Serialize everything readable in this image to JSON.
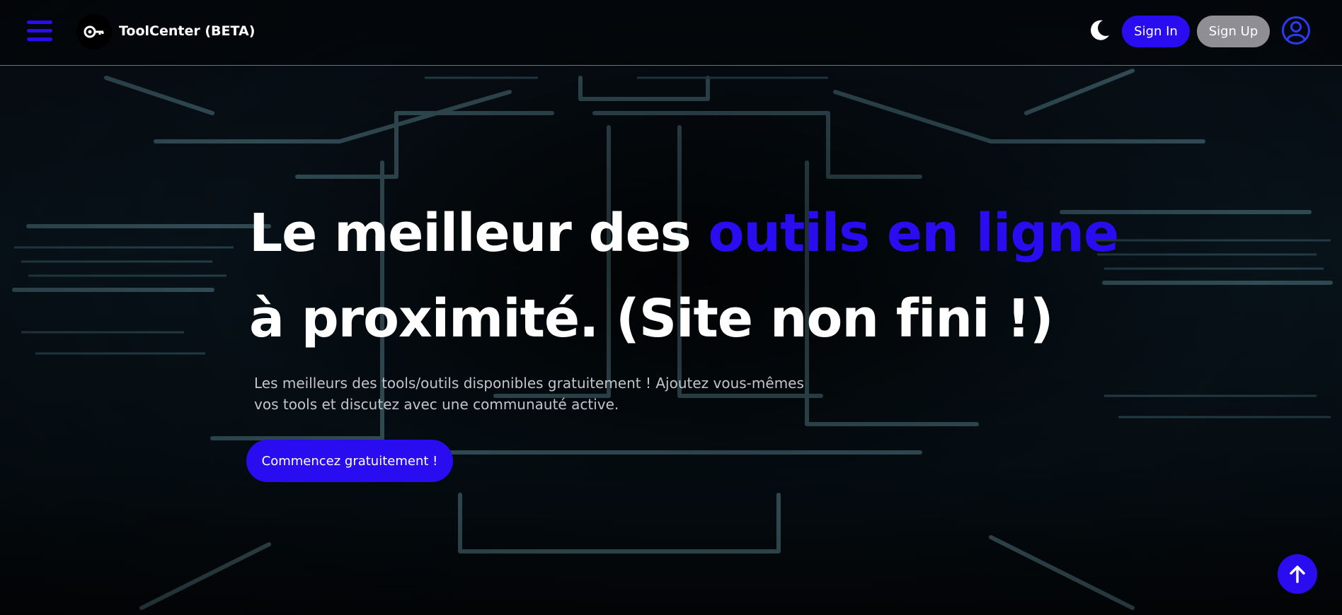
{
  "header": {
    "brand": "ToolCenter (BETA)",
    "sign_in_label": "Sign In",
    "sign_up_label": "Sign Up"
  },
  "hero": {
    "title_line1_before": "Le meilleur des ",
    "title_line1_accent": "outils en ligne",
    "title_line2": "à proximité. (Site non fini !)",
    "subtitle_line1": "Les meilleurs des tools/outils disponibles gratuitement ! Ajoutez vous-mêmes",
    "subtitle_line2": "vos tools et discutez avec une communauté active.",
    "cta_label": "Commencez gratuitement !"
  },
  "icons": {
    "menu": "hamburger-menu-icon",
    "logo": "key-logo-icon",
    "theme": "moon-icon",
    "account": "user-account-icon",
    "scroll_top": "arrow-up-icon"
  },
  "colors": {
    "accent": "#2a0cf0",
    "secondary_button": "#8e8e94",
    "text": "#ffffff",
    "subtitle": "#c4c4cc"
  }
}
